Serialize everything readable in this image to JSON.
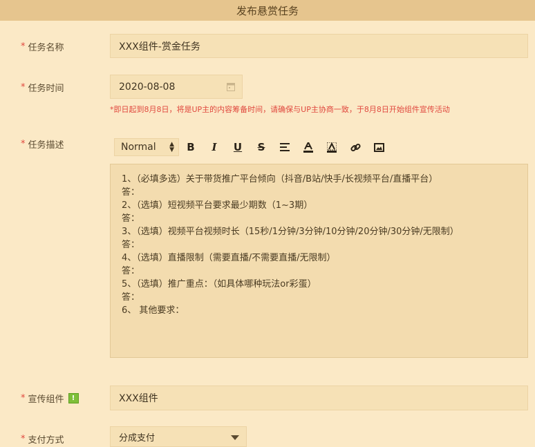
{
  "header": {
    "title": "发布悬赏任务"
  },
  "required_mark": "*",
  "task_name": {
    "label": "任务名称",
    "value": "XXX组件-赏金任务"
  },
  "task_time": {
    "label": "任务时间",
    "value": "2020-08-08",
    "icon": "calendar-icon",
    "hint": "*即日起到8月8日，将是UP主的内容筹备时间，请确保与UP主协商一致，于8月8日开始组件宣传活动"
  },
  "task_desc": {
    "label": "任务描述",
    "toolbar": {
      "format": "Normal",
      "bold": "B",
      "italic": "I",
      "underline": "U",
      "strike": "S"
    },
    "lines": [
      "1、（必填多选）关于带货推广平台倾向（抖音/B站/快手/长视频平台/直播平台）",
      "答：",
      "2、（选填）短视频平台要求最少期数（1~3期）",
      "答：",
      "3、（选填）视频平台视频时长（15秒/1分钟/3分钟/10分钟/20分钟/30分钟/无限制）",
      "答：",
      "4、（选填）直播限制（需要直播/不需要直播/无限制）",
      "答：",
      "5、（选填）推广重点：（如具体哪种玩法or彩蛋）",
      "答：",
      "6、 其他要求："
    ]
  },
  "promo_component": {
    "label": "宣传组件",
    "value": "XXX组件",
    "badge": "!"
  },
  "payment": {
    "label": "支付方式",
    "value": "分成支付"
  }
}
